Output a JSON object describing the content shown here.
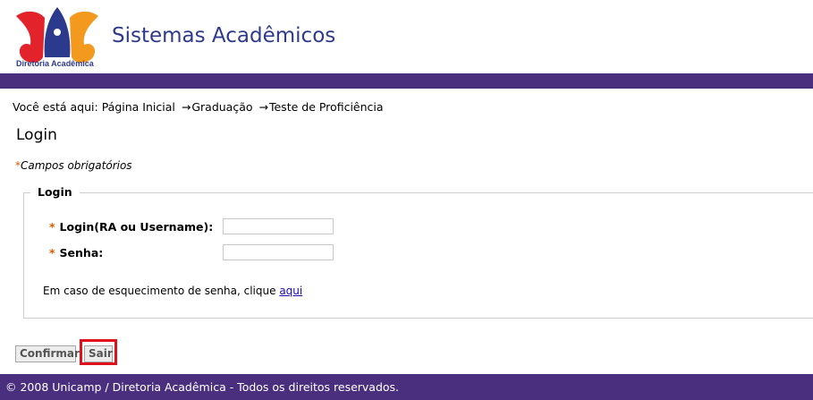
{
  "header": {
    "logo_caption": "Diretoria Acadêmica",
    "site_title": "Sistemas Acadêmicos"
  },
  "breadcrumb": {
    "prefix": "Você está aqui:",
    "items": [
      "Página Inicial",
      "Graduação",
      "Teste de Proficiência"
    ],
    "separator": "→"
  },
  "page": {
    "title": "Login",
    "required_star": "*",
    "required_note": "Campos obrigatórios"
  },
  "form": {
    "legend": "Login",
    "fields": [
      {
        "label": "Login(RA ou Username):",
        "value": ""
      },
      {
        "label": "Senha:",
        "value": ""
      }
    ],
    "hint_text": "Em caso de esquecimento de senha, clique",
    "hint_link": "aqui"
  },
  "buttons": {
    "confirm": "Confirmar",
    "exit": "Sair"
  },
  "footer": {
    "text": "© 2008 Unicamp / Diretoria Acadêmica - Todos os direitos reservados."
  },
  "colors": {
    "brand_purple": "#4b2f7f",
    "title_blue": "#2e3a8c",
    "required_orange": "#d65a00",
    "highlight_red": "#e0101c"
  },
  "icons": {
    "logo": "diretoria-academica-logo"
  }
}
